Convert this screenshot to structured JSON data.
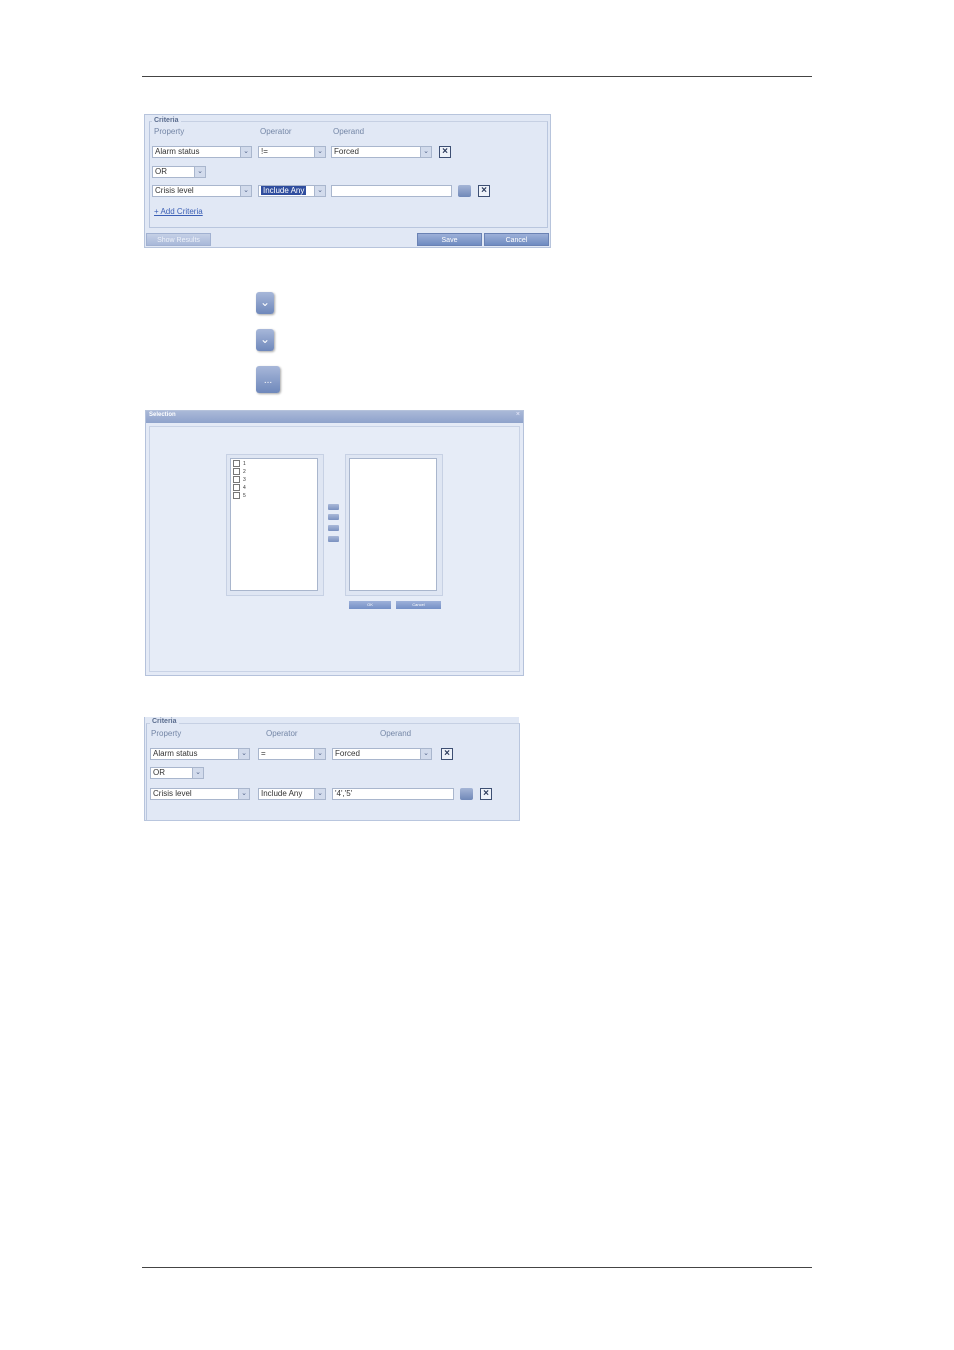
{
  "panel1": {
    "legend": "Criteria",
    "headers": {
      "property": "Property",
      "operator": "Operator",
      "operand": "Operand"
    },
    "row1": {
      "property": "Alarm status",
      "operator": "!=",
      "operand": "Forced"
    },
    "logic": "OR",
    "row2": {
      "property": "Crisis level",
      "operator": "Include Any",
      "operand": ""
    },
    "add_link": "+ Add Criteria",
    "buttons": {
      "show_results": "Show Results",
      "save": "Save",
      "cancel": "Cancel"
    }
  },
  "icons": {
    "dots_label": "..."
  },
  "dialog": {
    "title": "Selection",
    "close": "×",
    "options": [
      "1",
      "2",
      "3",
      "4",
      "5"
    ],
    "ok": "OK",
    "cancel": "Cancel"
  },
  "panel2": {
    "legend": "Criteria",
    "headers": {
      "property": "Property",
      "operator": "Operator",
      "operand": "Operand"
    },
    "row1": {
      "property": "Alarm status",
      "operator": "=",
      "operand": "Forced"
    },
    "logic": "OR",
    "row2": {
      "property": "Crisis level",
      "operator": "Include Any",
      "operand": "'4','5'"
    }
  },
  "theme": {
    "panel_bg": "#e1e8f5",
    "button_blue": "#6f8bc1",
    "highlight": "#2f4d9e"
  }
}
